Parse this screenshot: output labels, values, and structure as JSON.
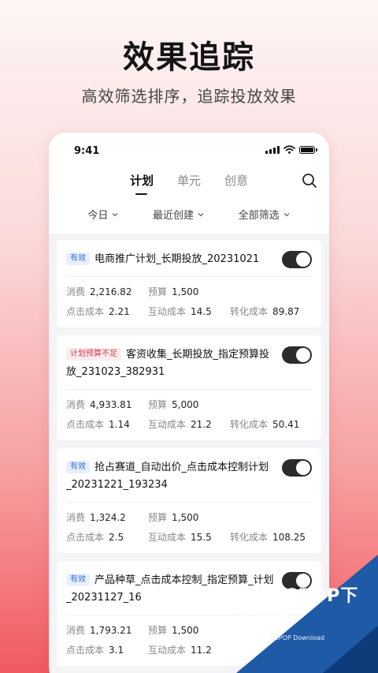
{
  "hero": {
    "title": "效果追踪",
    "subtitle": "高效筛选排序，追踪投放效果"
  },
  "status_bar": {
    "time": "9:41"
  },
  "tabs": [
    {
      "label": "计划",
      "active": true
    },
    {
      "label": "单元",
      "active": false
    },
    {
      "label": "创意",
      "active": false
    }
  ],
  "filters": [
    {
      "label": "今日"
    },
    {
      "label": "最近创建"
    },
    {
      "label": "全部筛选"
    }
  ],
  "metric_labels": {
    "spend": "消费",
    "budget": "预算",
    "cpc": "点击成本",
    "interaction_cost": "互动成本",
    "conversion_cost": "转化成本"
  },
  "campaigns": [
    {
      "badge": "有效",
      "badge_type": "ok",
      "name": "电商推广计划_长期投放_20231021",
      "enabled": true,
      "spend": "2,216.82",
      "budget": "1,500",
      "cpc": "2.21",
      "interaction_cost": "14.5",
      "conversion_cost": "89.87"
    },
    {
      "badge": "计划预算不足",
      "badge_type": "warn",
      "name": "客资收集_长期投放_指定预算投放_231023_382931",
      "enabled": true,
      "spend": "4,933.81",
      "budget": "5,000",
      "cpc": "1.14",
      "interaction_cost": "21.2",
      "conversion_cost": "50.41"
    },
    {
      "badge": "有效",
      "badge_type": "ok",
      "name": "抢占赛道_自动出价_点击成本控制计划_20231221_193234",
      "enabled": true,
      "spend": "1,324.2",
      "budget": "1,500",
      "cpc": "2.5",
      "interaction_cost": "15.5",
      "conversion_cost": "108.25"
    },
    {
      "badge": "有效",
      "badge_type": "ok",
      "name": "产品种草_点击成本控制_指定预算_计划_20231127_16",
      "enabled": true,
      "spend": "1,793.21",
      "budget": "1,500",
      "cpc": "3.1",
      "interaction_cost": "11.2",
      "conversion_cost": ""
    }
  ],
  "watermark": {
    "brand": "PCPOP下载",
    "sub": "PCPOP Download"
  },
  "colors": {
    "toggle_on": "#2b2b2b",
    "badge_ok": "#3b6de0",
    "badge_warn": "#d43f4e"
  }
}
